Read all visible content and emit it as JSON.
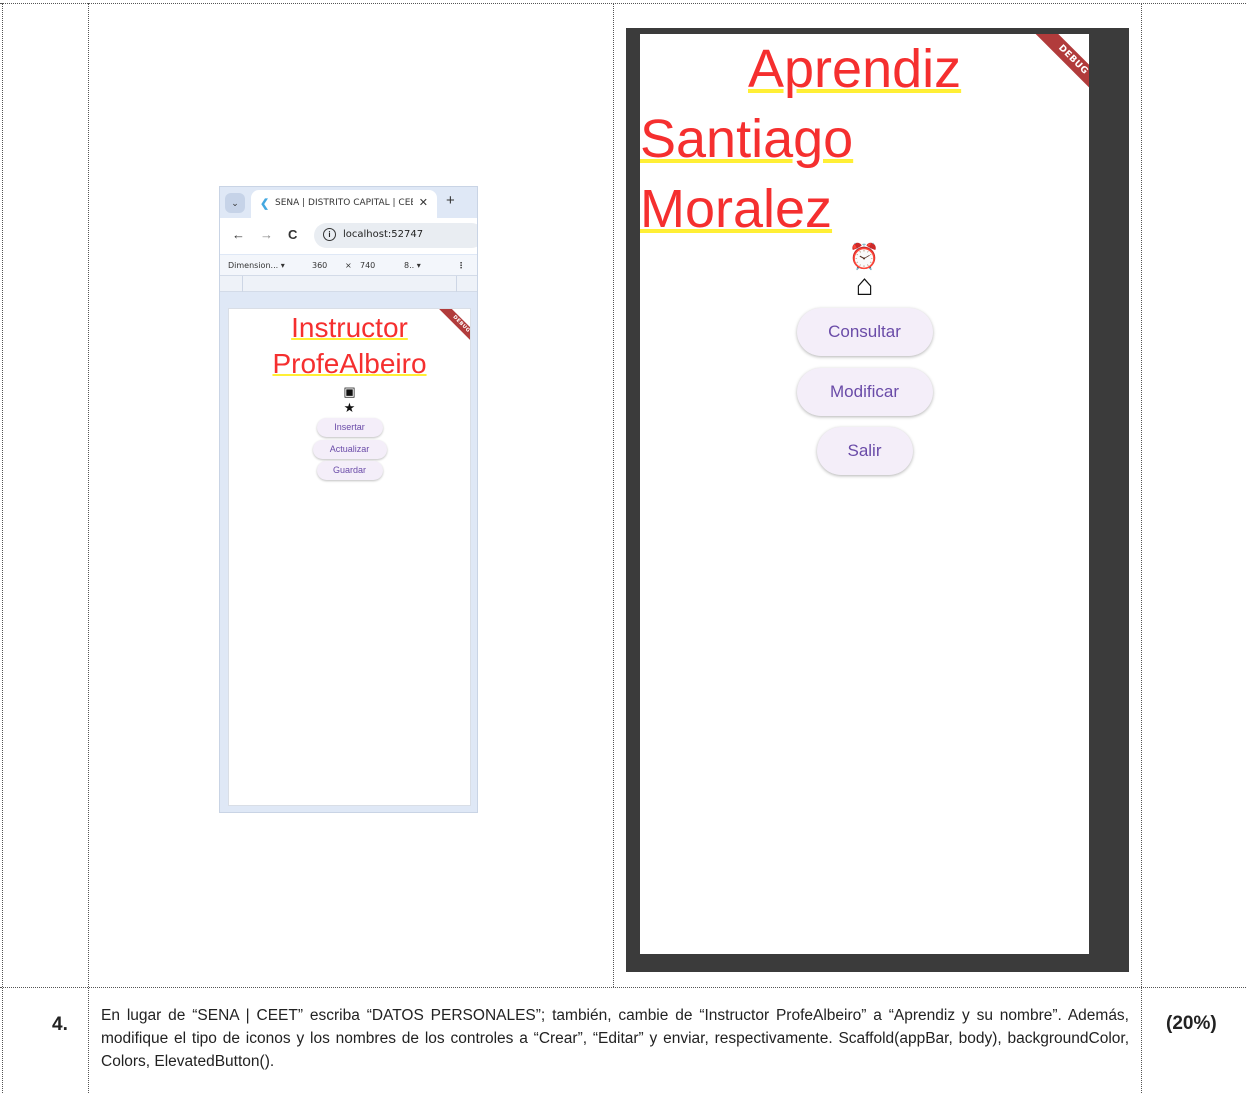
{
  "left_browser": {
    "tab_title": "SENA | DISTRITO CAPITAL | CEET",
    "tab_close": "✕",
    "new_tab": "+",
    "tab_dropdown": "⌄",
    "nav_back": "←",
    "nav_forward": "→",
    "nav_reload": "C",
    "site_info": "ⓘ",
    "url": "localhost:52747",
    "devtools": {
      "device": "Dimension... ▾",
      "width": "360",
      "times": "×",
      "height": "740",
      "zoom": "8.. ▾",
      "more": "⋮"
    },
    "app": {
      "debug_banner": "DEBUG",
      "title_line1": "Instructor",
      "title_line2": "ProfeAlbeiro",
      "icon1": "calculator-icon",
      "icon1_glyph": "▣",
      "icon2": "star-icon",
      "icon2_glyph": "★",
      "buttons": [
        "Insertar",
        "Actualizar",
        "Guardar"
      ]
    }
  },
  "right_phone": {
    "debug_banner": "DEBUG",
    "title_line1": "Aprendiz",
    "title_line2": "Santiago",
    "title_line3": "Moralez",
    "icon1": "alarm-icon",
    "icon1_glyph": "⏰",
    "icon2": "house-icon",
    "icon2_glyph": "⌂",
    "buttons": [
      "Consultar",
      "Modificar",
      "Salir"
    ]
  },
  "task_row": {
    "number": "4.",
    "text": "En lugar de “SENA | CEET” escriba “DATOS PERSONALES”; también, cambie de “Instructor ProfeAlbeiro” a “Aprendiz y su nombre”. Además, modifique el tipo de iconos y los nombres de los controles a “Crear”, “Editar” y enviar, respectivamente. Scaffold(appBar, body), backgroundColor, Colors, ElevatedButton().",
    "percentage": "(20%)"
  },
  "colors": {
    "title_red": "#f52f2f",
    "underline_yellow": "#ffef35",
    "button_bg": "#f4eef9",
    "button_text": "#6a4ba8",
    "emulator_frame": "#3b3b3b",
    "debug_ribbon": "#b13b3b"
  }
}
